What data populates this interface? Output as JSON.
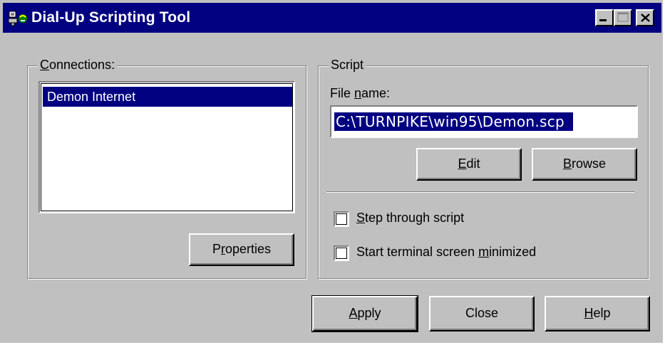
{
  "window": {
    "title": "Dial-Up Scripting Tool",
    "icon": "dialup-app-icon",
    "controls": [
      "minimize-icon",
      "maximize-icon",
      "close-icon"
    ]
  },
  "connections": {
    "legend_accel": "C",
    "legend_rest": "onnections:",
    "items": [
      "Demon Internet"
    ],
    "selected": "Demon Internet",
    "properties_pre": "P",
    "properties_accel": "r",
    "properties_post": "operties"
  },
  "script": {
    "legend": "Script",
    "file_label_pre": "File ",
    "file_label_accel": "n",
    "file_label_post": "ame:",
    "file_value": "C:\\TURNPIKE\\win95\\Demon.scp",
    "edit_accel": "E",
    "edit_rest": "dit",
    "browse_accel": "B",
    "browse_rest": "rowse",
    "step_accel": "S",
    "step_rest": "tep through script",
    "step_checked": false,
    "minimized_pre": "Start terminal screen ",
    "minimized_accel": "m",
    "minimized_post": "inimized",
    "minimized_checked": false
  },
  "footer": {
    "apply_accel": "A",
    "apply_rest": "pply",
    "close_label": "Close",
    "help_accel": "H",
    "help_rest": "elp"
  },
  "colors": {
    "titlebar": "#000080",
    "face": "#c0c0c0",
    "selection": "#000080"
  }
}
